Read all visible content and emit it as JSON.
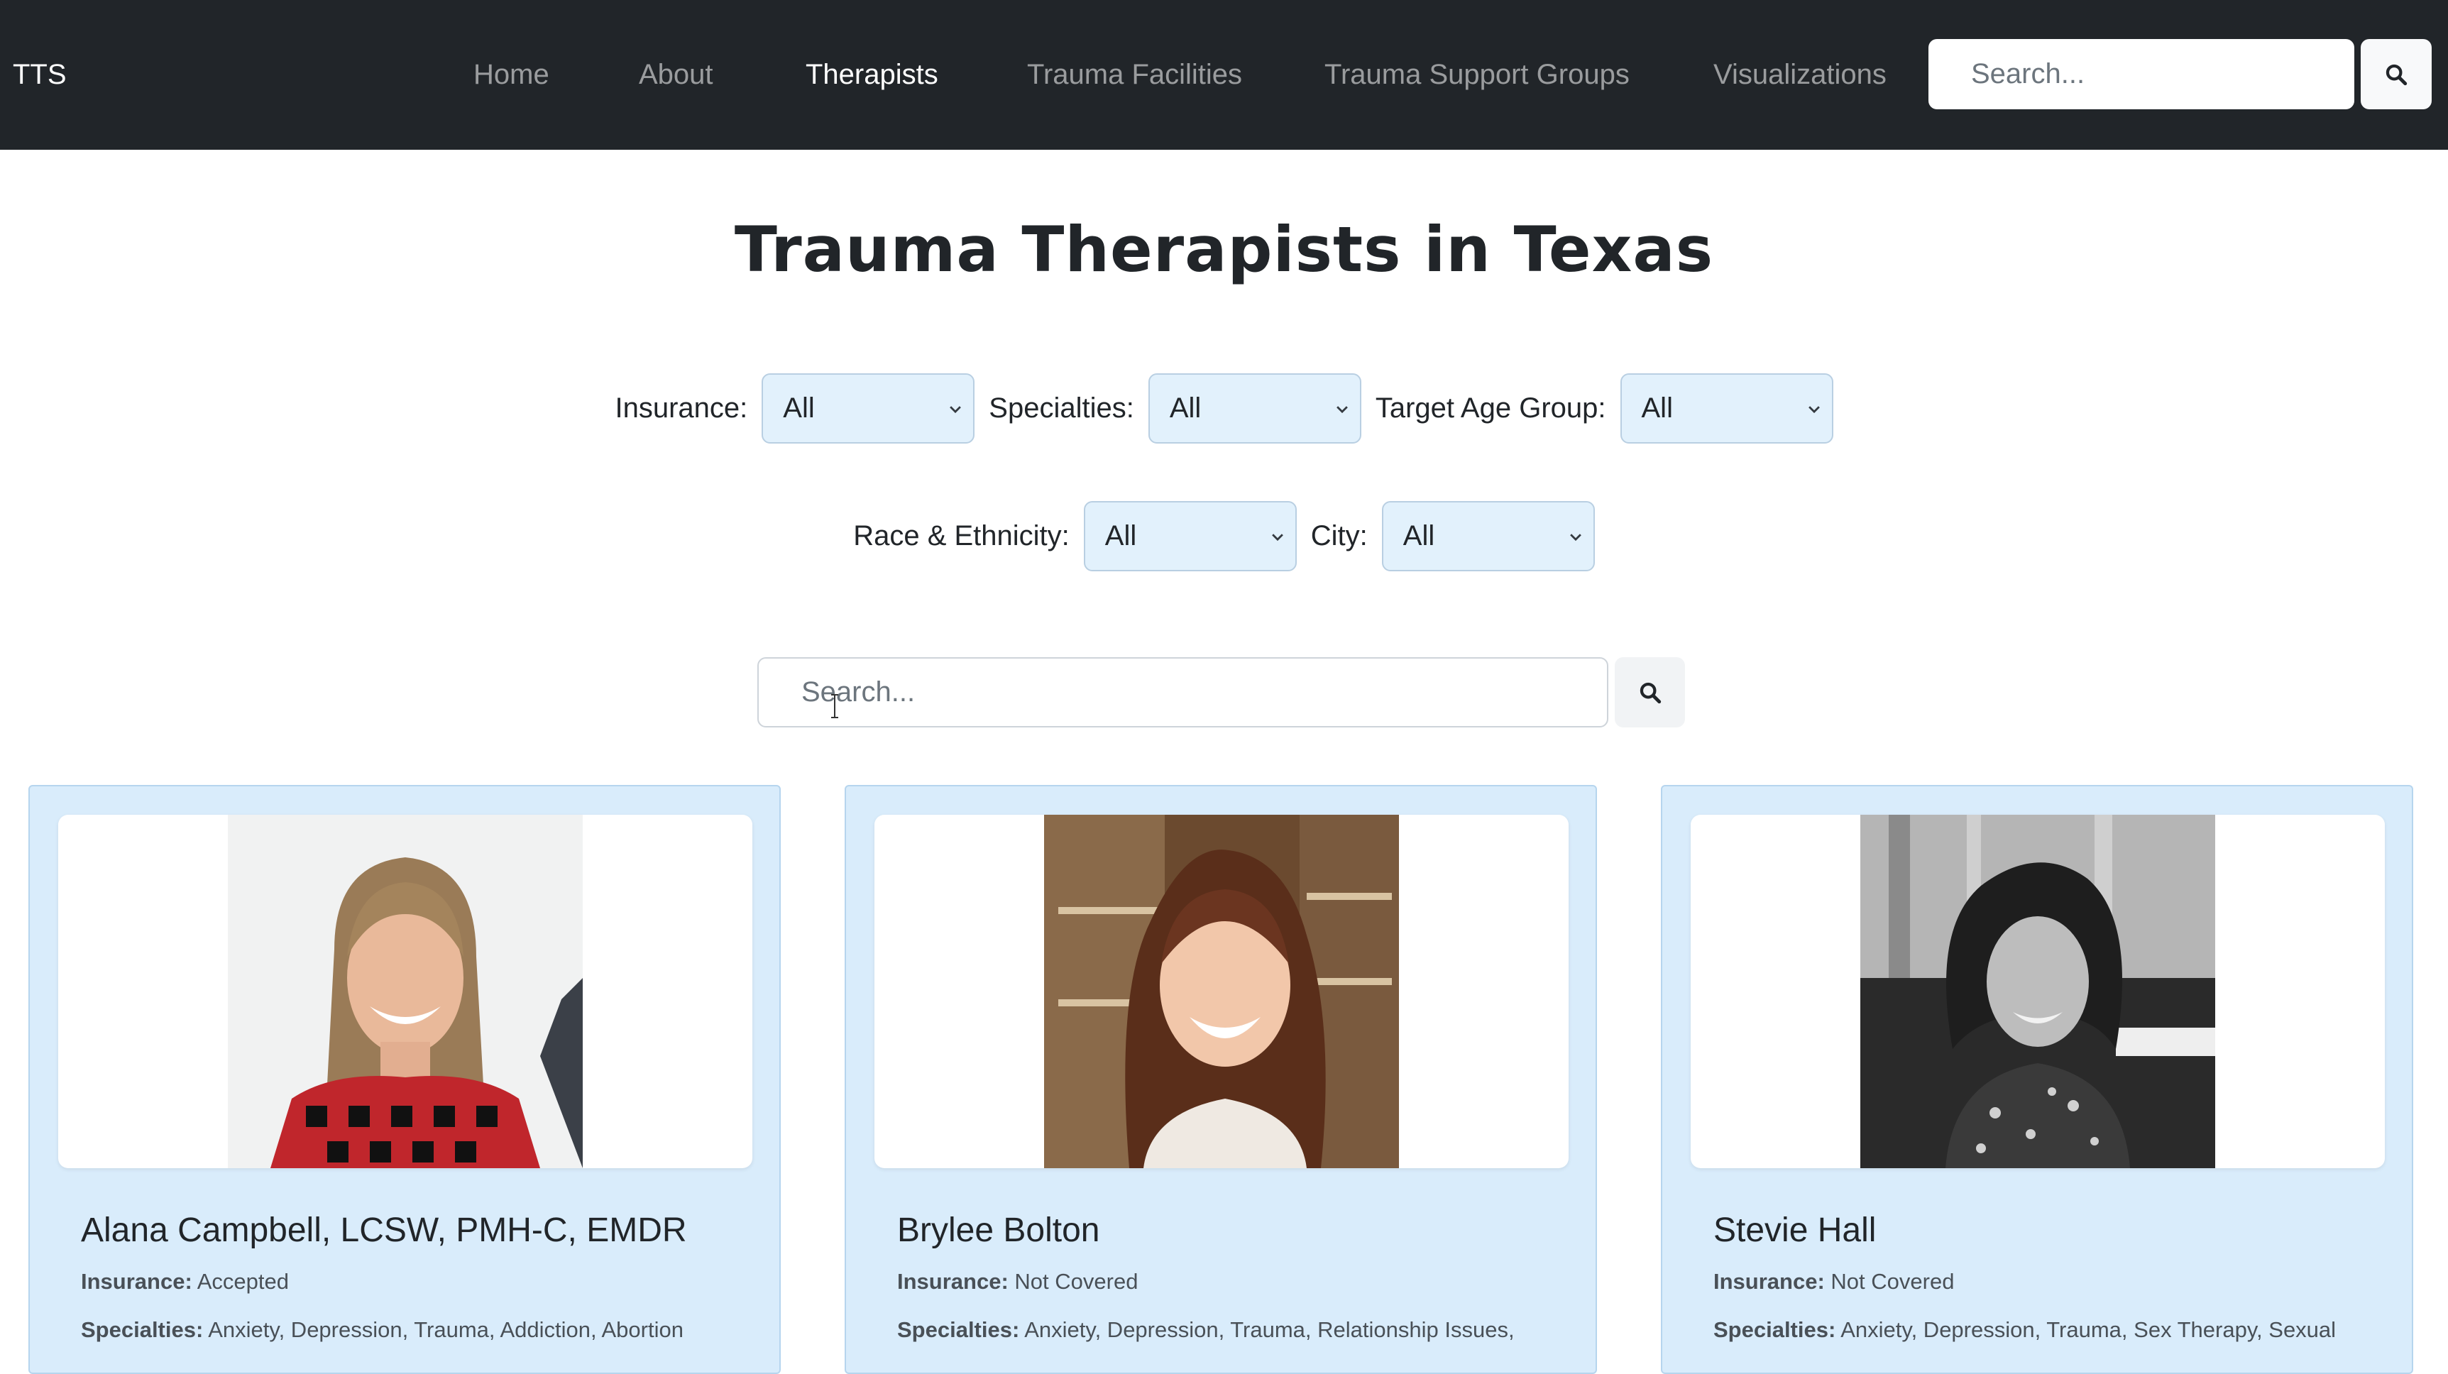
{
  "navbar": {
    "brand": "TTS",
    "links": [
      {
        "label": "Home",
        "active": false
      },
      {
        "label": "About",
        "active": false
      },
      {
        "label": "Therapists",
        "active": true
      },
      {
        "label": "Trauma Facilities",
        "active": false
      },
      {
        "label": "Trauma Support Groups",
        "active": false
      },
      {
        "label": "Visualizations",
        "active": false
      }
    ],
    "search_placeholder": "Search...",
    "search_icon": "search-icon"
  },
  "page": {
    "title": "Trauma Therapists in Texas"
  },
  "filters": {
    "insurance": {
      "label": "Insurance:",
      "value": "All"
    },
    "specialties": {
      "label": "Specialties:",
      "value": "All"
    },
    "target_age_group": {
      "label": "Target Age Group:",
      "value": "All"
    },
    "race_ethnicity": {
      "label": "Race & Ethnicity:",
      "value": "All"
    },
    "city": {
      "label": "City:",
      "value": "All"
    }
  },
  "main_search": {
    "placeholder": "Search...",
    "icon": "search-icon"
  },
  "cards": [
    {
      "name": "Alana Campbell, LCSW, PMH-C, EMDR",
      "insurance_label": "Insurance:",
      "insurance_value": "Accepted",
      "specialties_label": "Specialties:",
      "specialties_value": "Anxiety, Depression, Trauma, Addiction, Abortion"
    },
    {
      "name": "Brylee Bolton",
      "insurance_label": "Insurance:",
      "insurance_value": "Not Covered",
      "specialties_label": "Specialties:",
      "specialties_value": "Anxiety, Depression, Trauma, Relationship Issues,"
    },
    {
      "name": "Stevie Hall",
      "insurance_label": "Insurance:",
      "insurance_value": "Not Covered",
      "specialties_label": "Specialties:",
      "specialties_value": "Anxiety, Depression, Trauma, Sex Therapy, Sexual"
    }
  ],
  "colors": {
    "navbar_bg": "#212529",
    "card_bg": "#d9ecfb",
    "select_bg": "#e2f1fc"
  }
}
